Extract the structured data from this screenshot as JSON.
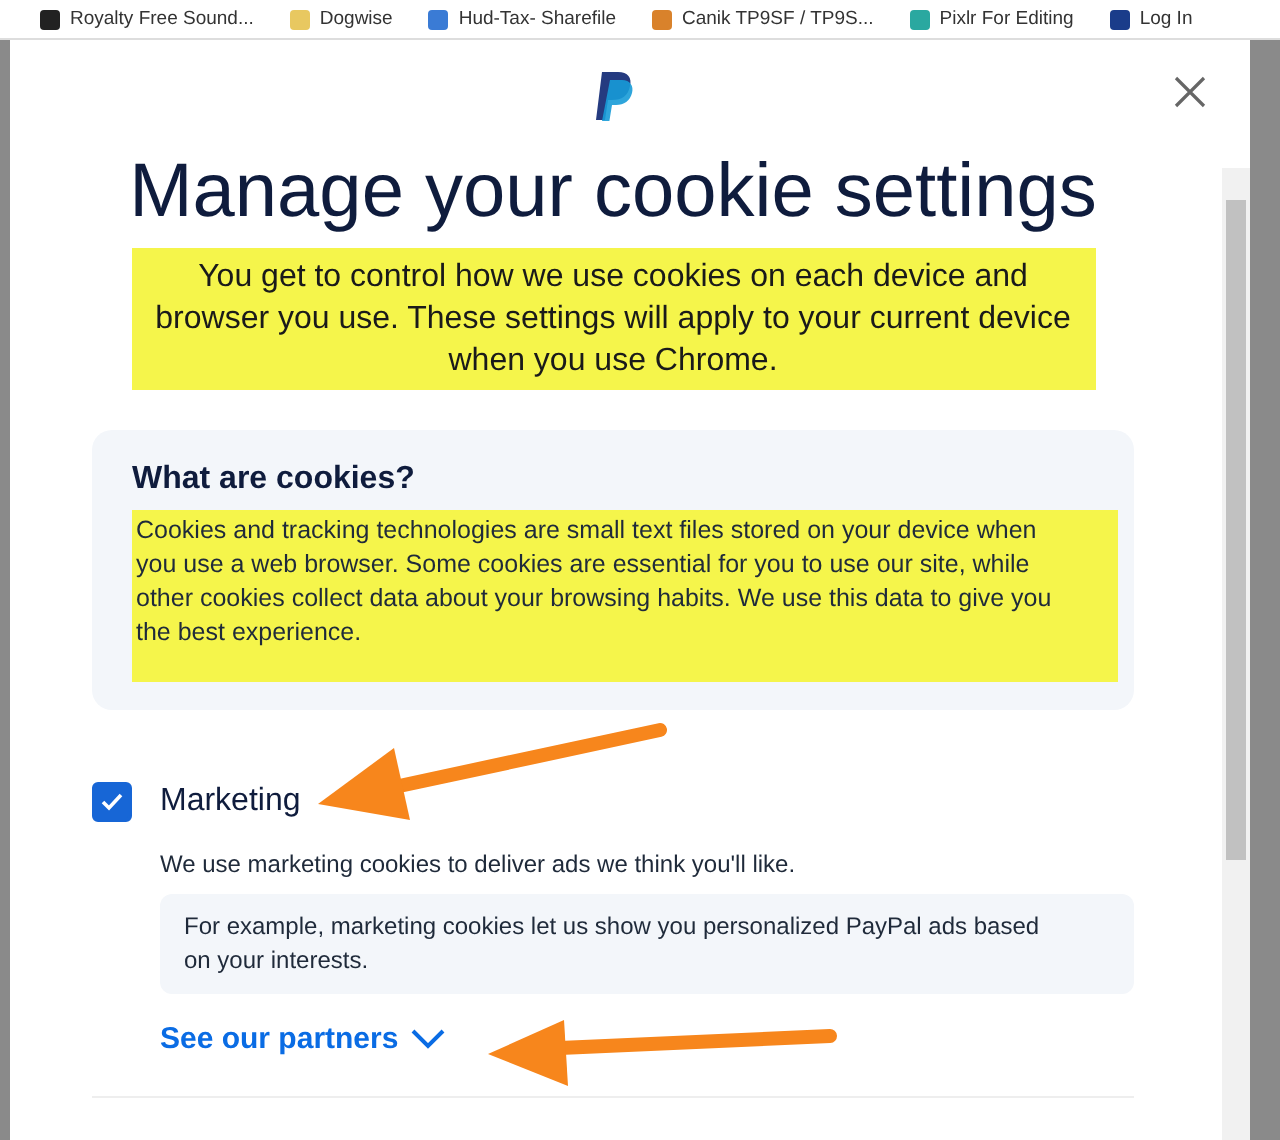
{
  "bookmarks": [
    {
      "label": "Royalty Free Sound..."
    },
    {
      "label": "Dogwise"
    },
    {
      "label": "Hud-Tax- Sharefile"
    },
    {
      "label": "Canik TP9SF / TP9S..."
    },
    {
      "label": "Pixlr For Editing"
    },
    {
      "label": "Log In"
    }
  ],
  "dialog": {
    "title": "Manage your cookie settings",
    "intro": "You get to control how we use cookies on each device and browser you use. These settings will apply to your current device when you use Chrome.",
    "info_card": {
      "heading": "What are cookies?",
      "body": "Cookies and tracking technologies are small text files stored on your device when you use a web browser. Some cookies are essential for you to use our site, while other cookies collect data about your browsing habits. We use this data to give you the best experience."
    },
    "categories": [
      {
        "label": "Marketing",
        "checked": true,
        "description": "We use marketing cookies to deliver ads we think you'll like.",
        "example": "For example, marketing cookies let us show you personalized PayPal ads based on your interests.",
        "link": "See our partners"
      }
    ]
  }
}
